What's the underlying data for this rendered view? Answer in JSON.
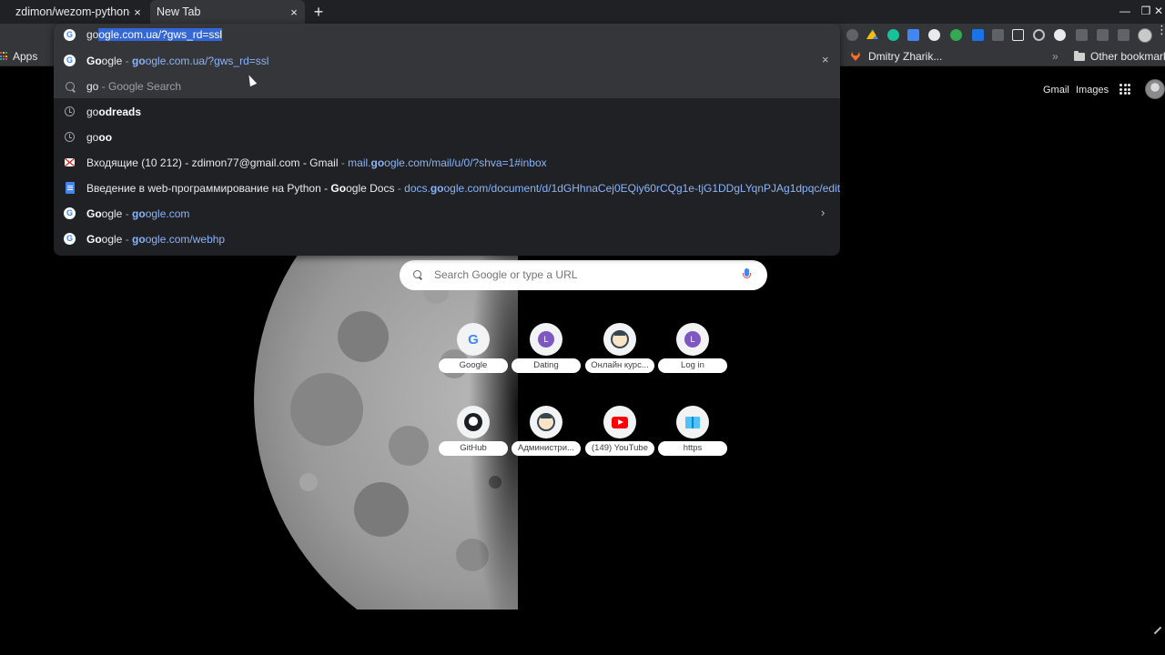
{
  "tabs": [
    {
      "title": "zdimon/wezom-python-c",
      "active": false
    },
    {
      "title": "New Tab",
      "active": true
    }
  ],
  "tab_close_glyph": "×",
  "new_tab_glyph": "+",
  "window_controls": {
    "minimize": "—",
    "maximize": "❐",
    "close": "✕"
  },
  "bookmarks": {
    "apps_label": "Apps",
    "items": [
      {
        "label": "Dmitry Zharik...",
        "icon": "gitlab-fox-icon"
      },
      {
        "label": "Other bookmarks",
        "icon": "folder-icon"
      }
    ],
    "overflow_glyph": "»"
  },
  "omnibox": {
    "typed": "go",
    "autocomplete": "ogle.com.ua/?gws_rd=ssl",
    "suggestions": [
      {
        "icon": "google",
        "bold": "Go",
        "rest": "ogle",
        "sep": " - ",
        "url_bold": "go",
        "url_rest": "ogle.com.ua/?gws_rd=ssl",
        "highlighted": true,
        "remove": "×"
      },
      {
        "icon": "search",
        "plain": "go",
        "dim": " - Google Search"
      },
      {
        "icon": "history",
        "plain": "go",
        "bold_tail": "odreads"
      },
      {
        "icon": "history",
        "plain": "go",
        "bold_tail": "oo"
      },
      {
        "icon": "gmail",
        "title": "Входящие (10 212) - zdimon77@gmail.com - Gmail",
        "sep": " - ",
        "url_pre": "mail.",
        "url_bold": "go",
        "url_rest": "ogle.com/mail/u/0/?shva=1#inbox"
      },
      {
        "icon": "docs",
        "title_pre": "Введение в web-программирование на Python - ",
        "title_bold": "Go",
        "title_rest": "ogle Docs",
        "sep": " - ",
        "url_pre": "docs.",
        "url_bold": "go",
        "url_rest": "ogle.com/document/d/1dGHhnaCej0EQiy60rCQg1e-tjG1DDgLYqnPJAg1dpqc/edit"
      },
      {
        "icon": "google",
        "bold": "Go",
        "rest": "ogle",
        "sep": " - ",
        "url_bold": "go",
        "url_rest": "ogle.com",
        "arrow": "›"
      },
      {
        "icon": "google",
        "bold": "Go",
        "rest": "ogle",
        "sep": " - ",
        "url_bold": "go",
        "url_rest": "ogle.com/webhp"
      }
    ]
  },
  "ntp": {
    "gmail_link": "Gmail",
    "images_link": "Images",
    "search_placeholder": "Search Google or type a URL",
    "shortcuts_row1": [
      {
        "label": "Google",
        "icon": "google"
      },
      {
        "label": "Dating",
        "icon": "letter",
        "letter": "L"
      },
      {
        "label": "Онлайн курс...",
        "icon": "face"
      },
      {
        "label": "Log in",
        "icon": "letter",
        "letter": "L"
      }
    ],
    "shortcuts_row2": [
      {
        "label": "GitHub",
        "icon": "github"
      },
      {
        "label": "Администри...",
        "icon": "face"
      },
      {
        "label": "(149) YouTube",
        "icon": "youtube"
      },
      {
        "label": "https",
        "icon": "book"
      }
    ]
  },
  "colors": {
    "background": "#000000",
    "tabstrip": "#202124",
    "toolbar": "#35363a",
    "omnibox_bg": "#202124",
    "url_blue": "#8ab4f8",
    "selection": "#3367d6"
  }
}
